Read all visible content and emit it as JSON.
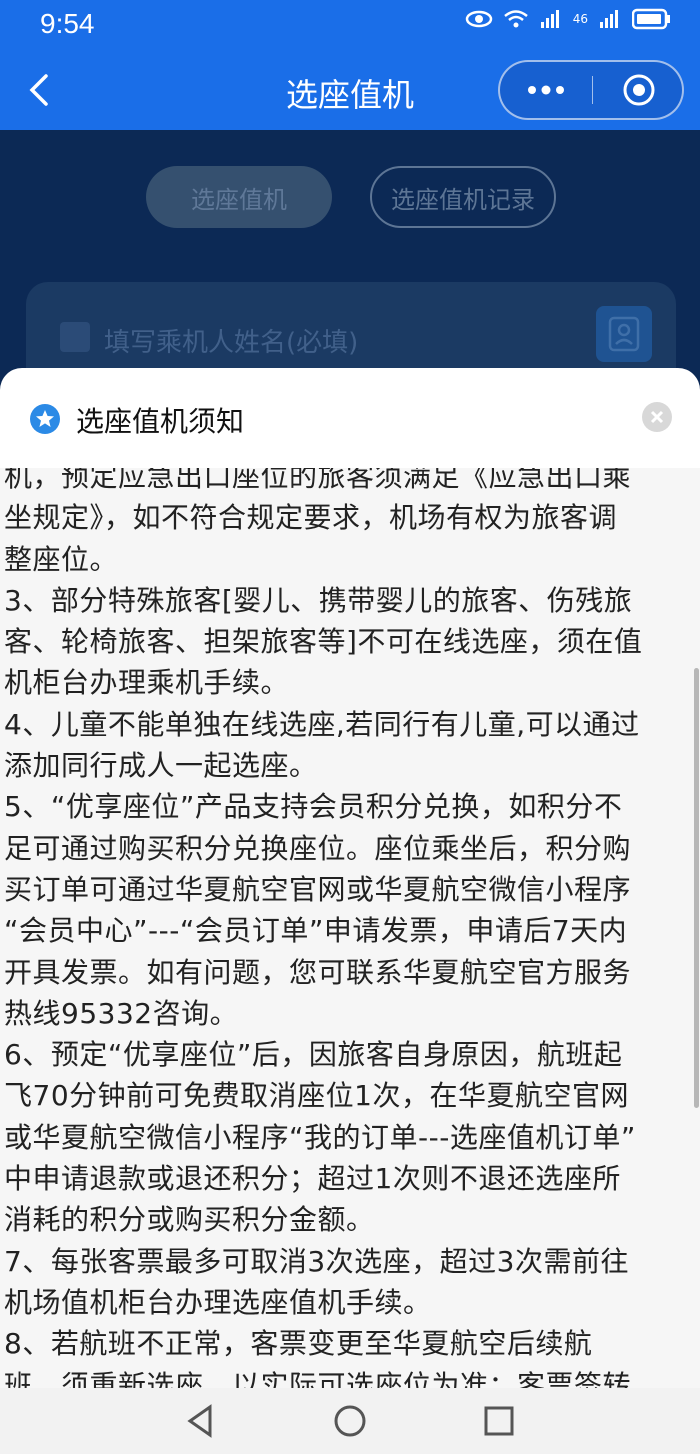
{
  "status": {
    "time": "9:54",
    "signal": "46"
  },
  "nav": {
    "title": "选座值机"
  },
  "tabs": [
    {
      "label": "选座值机"
    },
    {
      "label": "选座值机记录"
    }
  ],
  "form": {
    "name_placeholder": "填写乘机人姓名(必填)"
  },
  "sheet": {
    "title": "选座值机须知",
    "lines": [
      "机，预定应急出口座位的旅客须满足《应急出口乘",
      "坐规定》，如不符合规定要求，机场有权为旅客调",
      "整座位。",
      "3、部分特殊旅客[婴儿、携带婴儿的旅客、伤残旅",
      "客、轮椅旅客、担架旅客等]不可在线选座，须在值",
      "机柜台办理乘机手续。",
      "4、儿童不能单独在线选座,若同行有儿童,可以通过",
      "添加同行成人一起选座。",
      "5、“优享座位”产品支持会员积分兑换，如积分不",
      "足可通过购买积分兑换座位。座位乘坐后，积分购",
      "买订单可通过华夏航空官网或华夏航空微信小程序",
      "“会员中心”---“会员订单”申请发票，申请后7天内",
      "开具发票。如有问题，您可联系华夏航空官方服务",
      "热线95332咨询。",
      "6、预定“优享座位”后，因旅客自身原因，航班起",
      "飞70分钟前可免费取消座位1次，在华夏航空官网",
      "或华夏航空微信小程序“我的订单---选座值机订单”",
      "中申请退款或退还积分；超过1次则不退还选座所",
      "消耗的积分或购买积分金额。",
      "7、每张客票最多可取消3次选座，超过3次需前往",
      "机场值机柜台办理选座值机手续。",
      "8、若航班不正常，客票变更至华夏航空后续航",
      "班，须重新选座，以实际可选座位为准；客票签转"
    ]
  }
}
